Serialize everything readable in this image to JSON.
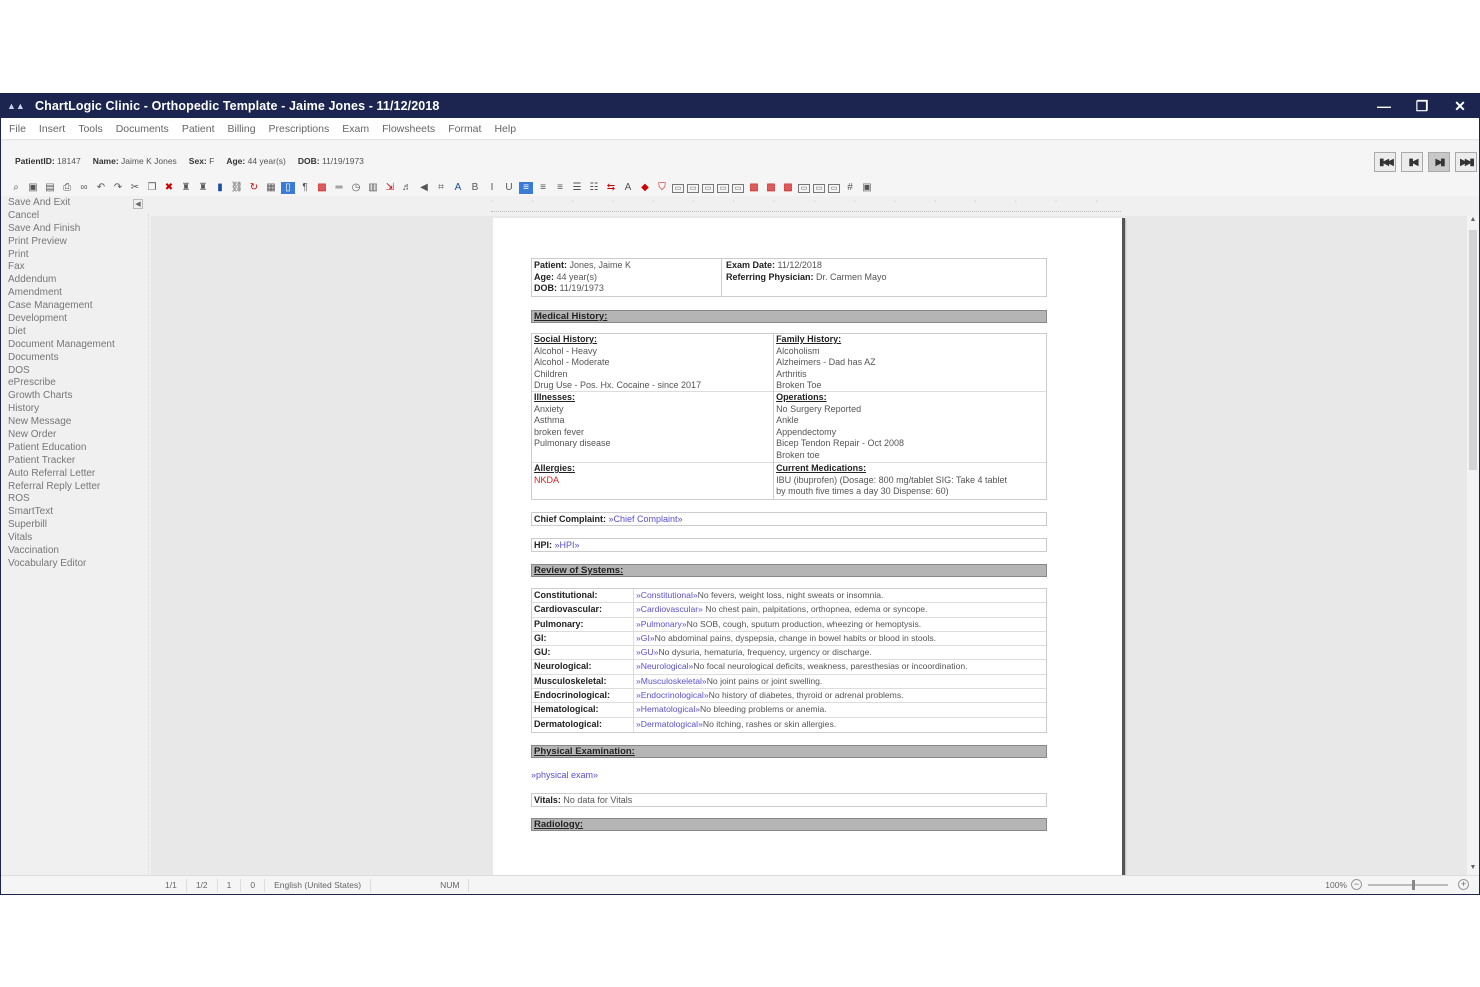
{
  "window": {
    "title": "ChartLogic Clinic - Orthopedic Template - Jaime Jones - 11/12/2018",
    "app_icon": "chartlogic-logo-icon",
    "minimize": "—",
    "restore": "❐",
    "close": "✕"
  },
  "menu": [
    "File",
    "Insert",
    "Tools",
    "Documents",
    "Patient",
    "Billing",
    "Prescriptions",
    "Exam",
    "Flowsheets",
    "Format",
    "Help"
  ],
  "patient_bar": {
    "id_label": "PatientID:",
    "id_value": "18147",
    "name_label": "Name:",
    "name_value": "Jaime K Jones",
    "sex_label": "Sex:",
    "sex_value": "F",
    "age_label": "Age:",
    "age_value": "44 year(s)",
    "dob_label": "DOB:",
    "dob_value": "11/19/1973"
  },
  "nav_buttons": [
    "first-record-icon",
    "previous-record-icon",
    "next-record-icon",
    "last-record-icon"
  ],
  "sidebar": [
    "Save And Exit",
    "Cancel",
    "Save And Finish",
    "Print Preview",
    "Print",
    "Fax",
    "Addendum",
    "Amendment",
    "Case Management",
    "Development",
    "Diet",
    "Document Management",
    "Documents",
    "DOS",
    "ePrescribe",
    "Growth Charts",
    "History",
    "New Message",
    "New Order",
    "Patient Education",
    "Patient Tracker",
    "Auto Referral Letter",
    "Referral Reply Letter",
    "ROS",
    "SmartText",
    "Superbill",
    "Vitals",
    "Vaccination",
    "Vocabulary Editor"
  ],
  "document": {
    "header": {
      "patient_label": "Patient:",
      "patient_value": "Jones, Jaime K",
      "age_label": "Age:",
      "age_value": "44 year(s)",
      "dob_label": "DOB:",
      "dob_value": "11/19/1973",
      "exam_label": "Exam Date:",
      "exam_value": "11/12/2018",
      "ref_label": "Referring Physician:",
      "ref_value": "Dr. Carmen Mayo"
    },
    "medical_history_title": "Medical History:",
    "social_history": {
      "title": "Social History:",
      "items": [
        "Alcohol - Heavy",
        "Alcohol - Moderate",
        "Children",
        "Drug Use - Pos. Hx. Cocaine - since 2017"
      ]
    },
    "illnesses": {
      "title": "Illnesses:",
      "items": [
        "Anxiety",
        "Asthma",
        "broken fever",
        "Pulmonary disease"
      ]
    },
    "allergies": {
      "title": "Allergies:",
      "items": [
        "NKDA"
      ]
    },
    "family_history": {
      "title": "Family History:",
      "items": [
        "Alcoholism",
        "Alzheimers - Dad has AZ",
        "Arthritis",
        "Broken Toe"
      ]
    },
    "operations": {
      "title": "Operations:",
      "items": [
        "No Surgery Reported",
        "Ankle",
        "Appendectomy",
        "Bicep Tendon Repair - Oct 2008",
        "Broken toe"
      ]
    },
    "current_medications": {
      "title": "Current Medications:",
      "items": [
        "IBU (ibuprofen) (Dosage: 800 mg/tablet SIG: Take 4 tablet",
        "by mouth five times a day 30 Dispense: 60)"
      ]
    },
    "chief_complaint_label": "Chief Complaint:",
    "chief_complaint_value": "»Chief Complaint»",
    "hpi_label": "HPI:",
    "hpi_value": "»HPI»",
    "ros_title": "Review of Systems:",
    "ros": [
      {
        "label": "Constitutional:",
        "tag": "»Constitutional»",
        "text": "No fevers, weight loss, night sweats or insomnia."
      },
      {
        "label": "Cardiovascular:",
        "tag": "»Cardiovascular»",
        "text": " No chest pain, palpitations, orthopnea, edema or syncope."
      },
      {
        "label": "Pulmonary:",
        "tag": "»Pulmonary»",
        "text": "No SOB, cough, sputum production, wheezing or hemoptysis."
      },
      {
        "label": "GI:",
        "tag": "»GI»",
        "text": "No abdominal pains, dyspepsia, change in bowel habits or blood in stools."
      },
      {
        "label": "GU:",
        "tag": "»GU»",
        "text": "No dysuria, hematuria, frequency, urgency or discharge."
      },
      {
        "label": "Neurological:",
        "tag": "»Neurological»",
        "text": "No focal neurological deficits, weakness, paresthesias or incoordination."
      },
      {
        "label": "Musculoskeletal:",
        "tag": "»Musculoskeletal»",
        "text": "No joint pains or joint swelling."
      },
      {
        "label": "Endocrinological:",
        "tag": "»Endocrinological»",
        "text": "No history of diabetes, thyroid or adrenal problems."
      },
      {
        "label": "Hematological:",
        "tag": "»Hematological»",
        "text": "No bleeding problems or anemia."
      },
      {
        "label": "Dermatological:",
        "tag": "»Dermatological»",
        "text": "No itching, rashes or skin allergies."
      }
    ],
    "physical_exam_title": "Physical Examination:",
    "physical_exam_value": "»physical exam»",
    "vitals_label": "Vitals:",
    "vitals_value": "No data for Vitals",
    "radiology_title": "Radiology:"
  },
  "statusbar": {
    "page": "1/1",
    "section": "1/2",
    "line": "1",
    "col": "0",
    "language": "English (United States)",
    "num": "NUM",
    "zoom": "100%"
  },
  "colors": {
    "titlebar": "#1b2550",
    "section_header": "#b5b5b5",
    "allergy_red": "#d42020",
    "tag_purple": "#5a4fcf"
  }
}
